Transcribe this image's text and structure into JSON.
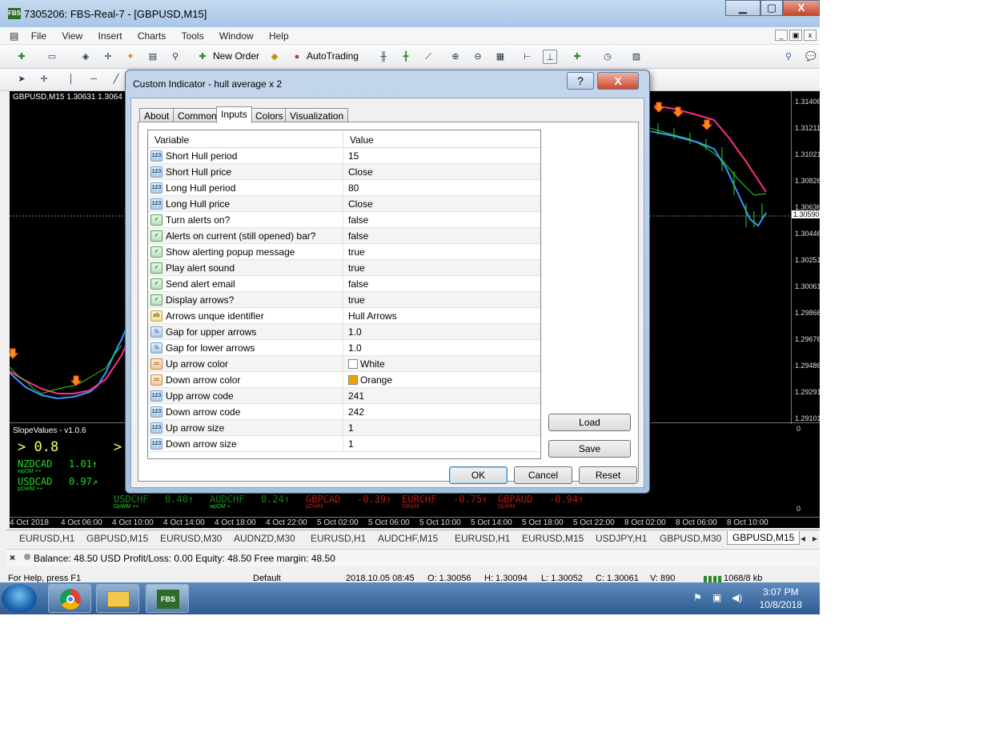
{
  "window": {
    "title": "7305206: FBS-Real-7 - [GBPUSD,M15]",
    "minimize": "▁",
    "maximize": "▢",
    "close": "X"
  },
  "menu": [
    "File",
    "View",
    "Insert",
    "Charts",
    "Tools",
    "Window",
    "Help"
  ],
  "toolbar": {
    "new_order": "New Order",
    "auto_trading": "AutoTrading"
  },
  "chart": {
    "symbol_label": "GBPUSD,M15  1.30631 1.3064",
    "price_ticks": [
      "1.31406",
      "1.31211",
      "1.31021",
      "1.30826",
      "1.30636",
      "1.30590",
      "1.30446",
      "1.30251",
      "1.30061",
      "1.29866",
      "1.29676",
      "1.29486",
      "1.29291",
      "1.29101"
    ],
    "sub_ticks": [
      "0",
      "0"
    ],
    "time_ticks": [
      "4 Oct 2018",
      "4 Oct 06:00",
      "4 Oct 10:00",
      "4 Oct 14:00",
      "4 Oct 18:00",
      "4 Oct 22:00",
      "5 Oct 02:00",
      "5 Oct 06:00",
      "5 Oct 10:00",
      "5 Oct 14:00",
      "5 Oct 18:00",
      "5 Oct 22:00",
      "8 Oct 02:00",
      "8 Oct 06:00",
      "8 Oct 10:00"
    ],
    "indicator_name": "SlopeValues - v1.0.6",
    "big_value": "> 0.8",
    "big_value2": ">",
    "pairs": [
      {
        "name": "NZDCAD",
        "value": "1.01↑",
        "sub": "wpDM ++"
      },
      {
        "name": "USDCAD",
        "value": "0.97↗",
        "sub": "pDWM ++"
      }
    ],
    "bottom_row": [
      {
        "name": "USDCHF",
        "value": "0.40↑",
        "sub": "DpWM ++"
      },
      {
        "name": "AUDCHF",
        "value": "0.24↑",
        "sub": "wpDM +"
      },
      {
        "name": "GBPCAD",
        "value": "-0.39↑",
        "sub": "pDWM"
      },
      {
        "name": "EURCHF",
        "value": "-0.75↑",
        "sub": "DWpM"
      },
      {
        "name": "GBPAUD",
        "value": "-0.94↑",
        "sub": "DpWM"
      }
    ]
  },
  "chart_tabs": [
    "EURUSD,H1",
    "GBPUSD,M15",
    "EURUSD,M30",
    "AUDNZD,M30",
    "EURUSD,H1",
    "AUDCHF,M15",
    "EURUSD,H1",
    "EURUSD,M15",
    "USDJPY,H1",
    "GBPUSD,M30",
    "GBPUSD,M15"
  ],
  "balance": "Balance: 48.50 USD  Profit/Loss: 0.00  Equity: 48.50  Free margin: 48.50",
  "status": {
    "help": "For Help, press F1",
    "profile": "Default",
    "time": "2018.10.05 08:45",
    "open": "O: 1.30056",
    "high": "H: 1.30094",
    "low": "L: 1.30052",
    "closep": "C: 1.30061",
    "volume": "V: 890",
    "traffic": "1068/8 kb"
  },
  "taskbar": {
    "fbs_label": "FBS",
    "time": "3:07 PM",
    "date": "10/8/2018"
  },
  "dialog": {
    "title": "Custom Indicator - hull average x 2",
    "help_btn": "?",
    "close_btn": "X",
    "tabs": [
      "About",
      "Common",
      "Inputs",
      "Colors",
      "Visualization"
    ],
    "active_tab": "Inputs",
    "col_variable": "Variable",
    "col_value": "Value",
    "rows": [
      {
        "icon": "123",
        "type": "int",
        "variable": "Short Hull period",
        "value": "15"
      },
      {
        "icon": "123",
        "type": "int",
        "variable": "Short Hull price",
        "value": "Close"
      },
      {
        "icon": "123",
        "type": "int",
        "variable": "Long Hull period",
        "value": "80"
      },
      {
        "icon": "123",
        "type": "int",
        "variable": "Long Hull price",
        "value": "Close"
      },
      {
        "icon": "✓",
        "type": "bool",
        "variable": "Turn alerts on?",
        "value": "false"
      },
      {
        "icon": "✓",
        "type": "bool",
        "variable": "Alerts on current (still opened) bar?",
        "value": "false"
      },
      {
        "icon": "✓",
        "type": "bool",
        "variable": "Show alerting popup message",
        "value": "true"
      },
      {
        "icon": "✓",
        "type": "bool",
        "variable": "Play alert sound",
        "value": "true"
      },
      {
        "icon": "✓",
        "type": "bool",
        "variable": "Send alert email",
        "value": "false"
      },
      {
        "icon": "✓",
        "type": "bool",
        "variable": "Display arrows?",
        "value": "true"
      },
      {
        "icon": "ab",
        "type": "str",
        "variable": "Arrows unque identifier",
        "value": "Hull Arrows"
      },
      {
        "icon": "½",
        "type": "dbl",
        "variable": "Gap for upper arrows",
        "value": "1.0"
      },
      {
        "icon": "½",
        "type": "dbl",
        "variable": "Gap for lower arrows",
        "value": "1.0"
      },
      {
        "icon": "▭",
        "type": "clr",
        "variable": "Up arrow color",
        "value": "White",
        "swatch": "#ffffff"
      },
      {
        "icon": "▭",
        "type": "clr",
        "variable": "Down arrow color",
        "value": "Orange",
        "swatch": "#f0a000"
      },
      {
        "icon": "123",
        "type": "int",
        "variable": "Upp arrow code",
        "value": "241"
      },
      {
        "icon": "123",
        "type": "int",
        "variable": "Down arrow code",
        "value": "242"
      },
      {
        "icon": "123",
        "type": "int",
        "variable": "Up arrow size",
        "value": "1"
      },
      {
        "icon": "123",
        "type": "int",
        "variable": "Down arrow size",
        "value": "1"
      }
    ],
    "load": "Load",
    "save": "Save",
    "ok": "OK",
    "cancel": "Cancel",
    "reset": "Reset"
  }
}
